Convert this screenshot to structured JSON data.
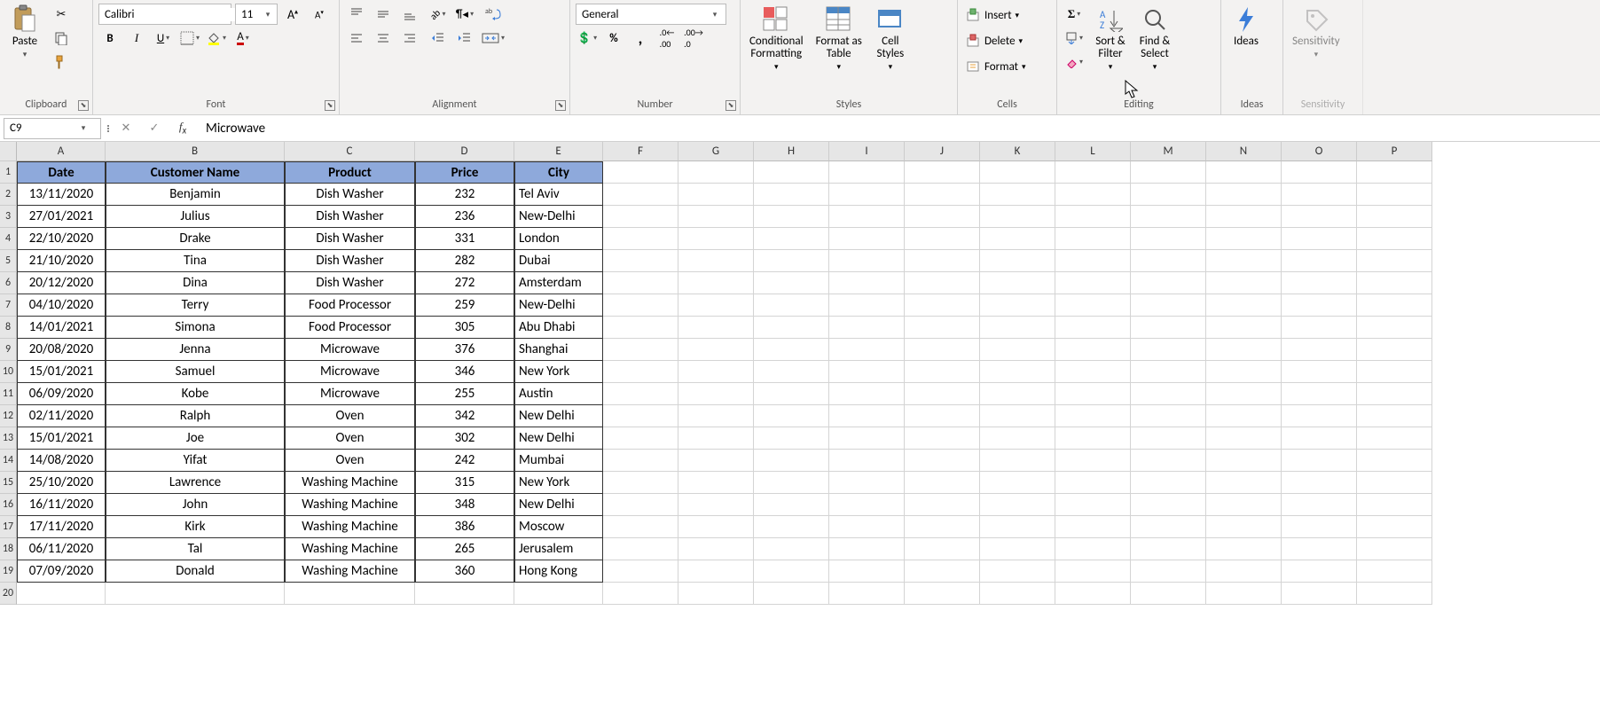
{
  "ribbon": {
    "clipboard": {
      "label": "Clipboard",
      "paste": "Paste"
    },
    "font": {
      "label": "Font",
      "name": "Calibri",
      "size": "11"
    },
    "alignment": {
      "label": "Alignment"
    },
    "number": {
      "label": "Number",
      "format": "General"
    },
    "styles": {
      "label": "Styles",
      "cf": "Conditional\nFormatting",
      "fat": "Format as\nTable",
      "cs": "Cell\nStyles"
    },
    "cells": {
      "label": "Cells",
      "insert": "Insert",
      "delete": "Delete",
      "format": "Format"
    },
    "editing": {
      "label": "Editing",
      "sort": "Sort &\nFilter",
      "find": "Find &\nSelect"
    },
    "ideas": {
      "label": "Ideas",
      "btn": "Ideas"
    },
    "sensitivity": {
      "label": "Sensitivity",
      "btn": "Sensitivity"
    }
  },
  "formulaBar": {
    "ref": "C9",
    "value": "Microwave"
  },
  "columns": [
    "A",
    "B",
    "C",
    "D",
    "E",
    "F",
    "G",
    "H",
    "I",
    "J",
    "K",
    "L",
    "M",
    "N",
    "O",
    "P"
  ],
  "headers": [
    "Date",
    "Customer Name",
    "Product",
    "Price",
    "City"
  ],
  "rows": [
    {
      "date": "13/11/2020",
      "name": "Benjamin",
      "product": "Dish Washer",
      "price": "232",
      "city": "Tel Aviv"
    },
    {
      "date": "27/01/2021",
      "name": "Julius",
      "product": "Dish Washer",
      "price": "236",
      "city": "New-Delhi"
    },
    {
      "date": "22/10/2020",
      "name": "Drake",
      "product": "Dish Washer",
      "price": "331",
      "city": "London"
    },
    {
      "date": "21/10/2020",
      "name": "Tina",
      "product": "Dish Washer",
      "price": "282",
      "city": "Dubai"
    },
    {
      "date": "20/12/2020",
      "name": "Dina",
      "product": "Dish Washer",
      "price": "272",
      "city": "Amsterdam"
    },
    {
      "date": "04/10/2020",
      "name": "Terry",
      "product": "Food Processor",
      "price": "259",
      "city": "New-Delhi"
    },
    {
      "date": "14/01/2021",
      "name": "Simona",
      "product": "Food Processor",
      "price": "305",
      "city": "Abu Dhabi"
    },
    {
      "date": "20/08/2020",
      "name": "Jenna",
      "product": "Microwave",
      "price": "376",
      "city": "Shanghai"
    },
    {
      "date": "15/01/2021",
      "name": "Samuel",
      "product": "Microwave",
      "price": "346",
      "city": "New York"
    },
    {
      "date": "06/09/2020",
      "name": "Kobe",
      "product": "Microwave",
      "price": "255",
      "city": "Austin"
    },
    {
      "date": "02/11/2020",
      "name": "Ralph",
      "product": "Oven",
      "price": "342",
      "city": "New Delhi"
    },
    {
      "date": "15/01/2021",
      "name": "Joe",
      "product": "Oven",
      "price": "302",
      "city": "New Delhi"
    },
    {
      "date": "14/08/2020",
      "name": "Yifat",
      "product": "Oven",
      "price": "242",
      "city": "Mumbai"
    },
    {
      "date": "25/10/2020",
      "name": "Lawrence",
      "product": "Washing Machine",
      "price": "315",
      "city": "New York"
    },
    {
      "date": "16/11/2020",
      "name": "John",
      "product": "Washing Machine",
      "price": "348",
      "city": "New Delhi"
    },
    {
      "date": "17/11/2020",
      "name": "Kirk",
      "product": "Washing Machine",
      "price": "386",
      "city": "Moscow"
    },
    {
      "date": "06/11/2020",
      "name": "Tal",
      "product": "Washing Machine",
      "price": "265",
      "city": "Jerusalem"
    },
    {
      "date": "07/09/2020",
      "name": "Donald",
      "product": "Washing Machine",
      "price": "360",
      "city": "Hong Kong"
    }
  ]
}
